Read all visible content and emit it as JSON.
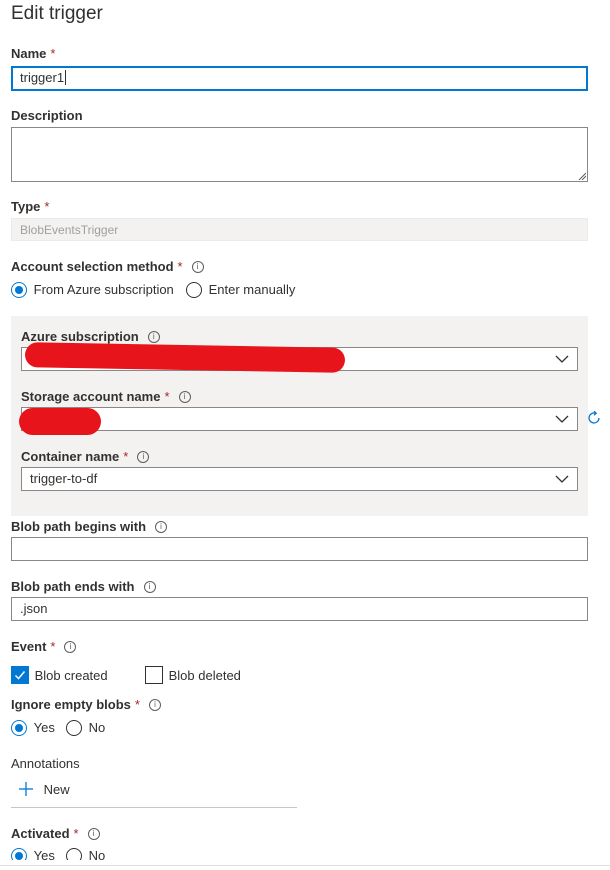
{
  "title": "Edit trigger",
  "required_mark": "*",
  "info_glyph": "i",
  "name": {
    "label": "Name",
    "value": "trigger1"
  },
  "description": {
    "label": "Description",
    "value": ""
  },
  "type": {
    "label": "Type",
    "value": "BlobEventsTrigger"
  },
  "account_selection": {
    "label": "Account selection method",
    "options": [
      {
        "label": "From Azure subscription",
        "selected": true
      },
      {
        "label": "Enter manually",
        "selected": false
      }
    ]
  },
  "azure_subscription": {
    "label": "Azure subscription"
  },
  "storage_account": {
    "label": "Storage account name"
  },
  "container": {
    "label": "Container name",
    "value": "trigger-to-df"
  },
  "blob_begins": {
    "label": "Blob path begins with",
    "value": ""
  },
  "blob_ends": {
    "label": "Blob path ends with",
    "value": ".json"
  },
  "event": {
    "label": "Event",
    "options": [
      {
        "label": "Blob created",
        "checked": true
      },
      {
        "label": "Blob deleted",
        "checked": false
      }
    ]
  },
  "ignore_empty": {
    "label": "Ignore empty blobs",
    "options": [
      {
        "label": "Yes",
        "selected": true
      },
      {
        "label": "No",
        "selected": false
      }
    ]
  },
  "annotations": {
    "label": "Annotations",
    "new_label": "New"
  },
  "activated": {
    "label": "Activated",
    "options": [
      {
        "label": "Yes",
        "selected": true
      },
      {
        "label": "No",
        "selected": false
      }
    ]
  },
  "colors": {
    "accent": "#0078d4",
    "required": "#a4262c",
    "redaction": "#e8141b",
    "panel": "#f3f2f1"
  },
  "icons": [
    "info-icon",
    "chevron-down-icon",
    "refresh-icon",
    "checkmark-icon",
    "plus-icon",
    "resize-grip-icon"
  ]
}
